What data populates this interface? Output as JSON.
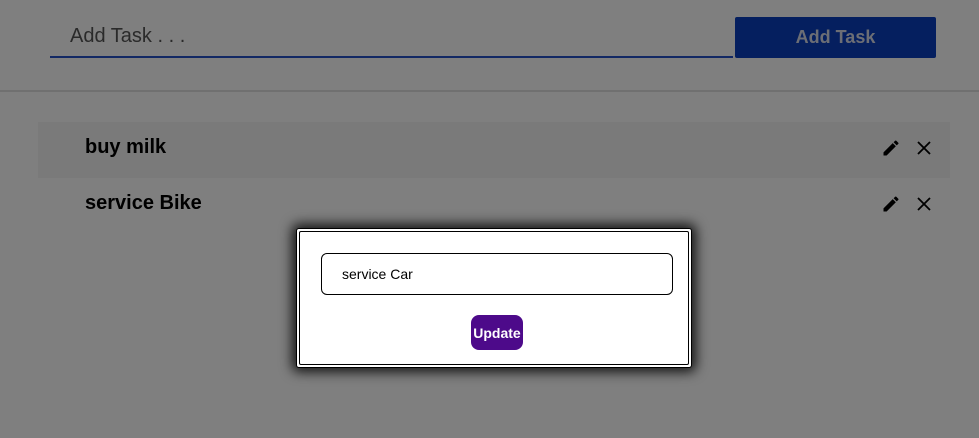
{
  "header": {
    "task_input_placeholder": "Add Task . . .",
    "task_input_value": "",
    "add_button_label": "Add Task"
  },
  "tasks": [
    {
      "text": "buy milk",
      "edit_icon": "pencil-icon",
      "delete_icon": "close-icon"
    },
    {
      "text": "service Bike",
      "edit_icon": "pencil-icon",
      "delete_icon": "close-icon"
    }
  ],
  "modal": {
    "edit_value": "service Car",
    "update_button_label": "Update"
  },
  "colors": {
    "add_button_bg": "#0a3ebf",
    "input_underline": "#2450c8",
    "update_button_bg": "#4d0a8a",
    "overlay": "rgba(0,0,0,0.5)"
  }
}
